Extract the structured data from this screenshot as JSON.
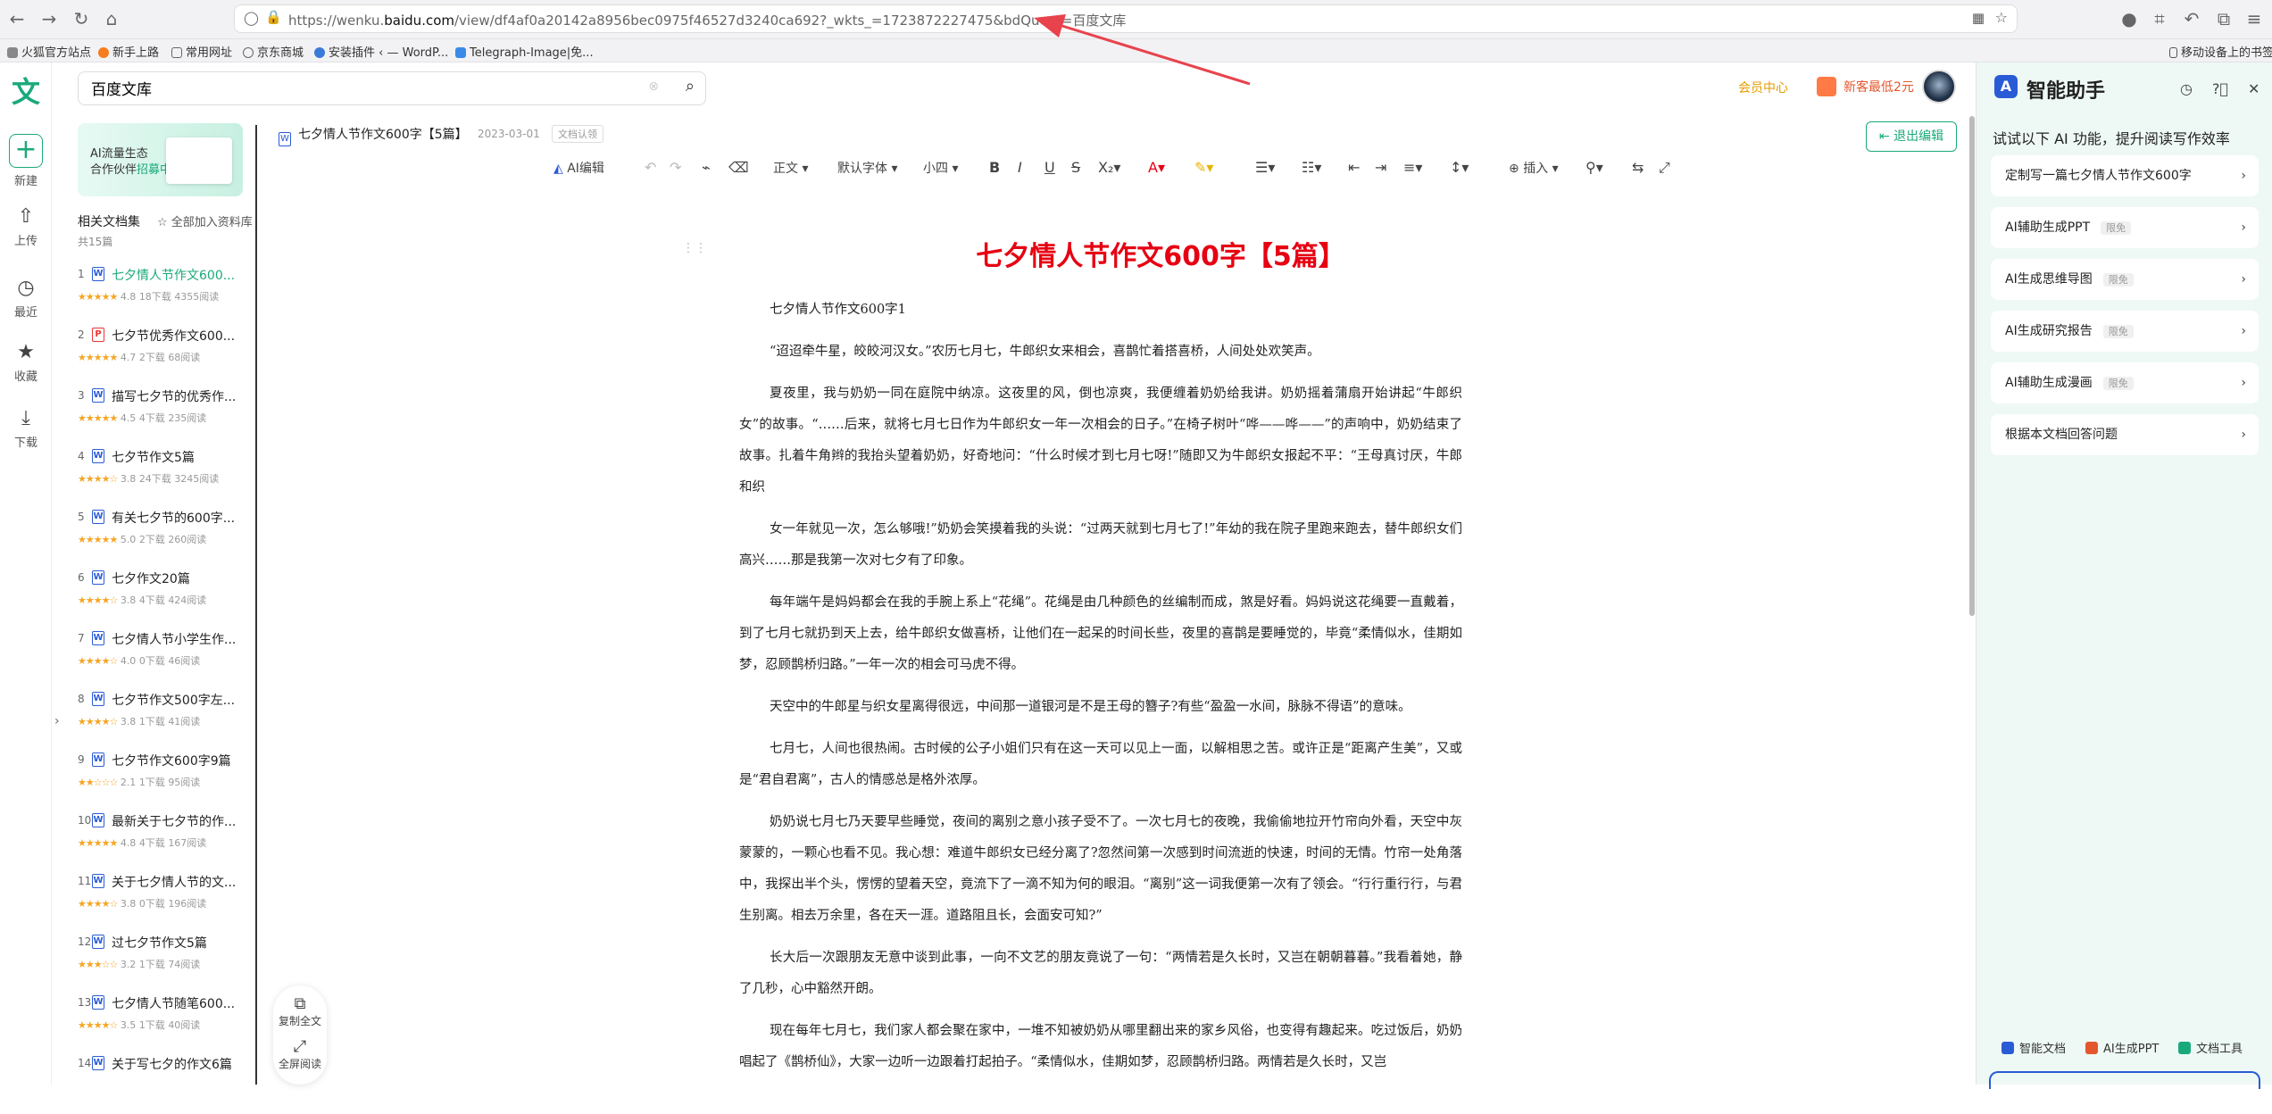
{
  "browser": {
    "url_prefix": "https://wenku.",
    "url_domain": "baidu.com",
    "url_rest": "/view/df4af0a20142a8956bec0975f46527d3240ca692?_wkts_=1723872227475&bdQuery=百度文库",
    "bookmarks": [
      "火狐官方站点",
      "新手上路",
      "常用网址",
      "京东商城",
      "安装插件 ‹ — WordP...",
      "Telegraph-Image|免..."
    ],
    "mobile_bookmarks": "移动设备上的书签"
  },
  "rail": {
    "logo": "文",
    "items": [
      {
        "label": "新建",
        "icon": "+"
      },
      {
        "label": "上传",
        "icon": "⇧"
      },
      {
        "label": "最近",
        "icon": "◷"
      },
      {
        "label": "收藏",
        "icon": "★"
      },
      {
        "label": "下载",
        "icon": "⤓"
      }
    ]
  },
  "search": {
    "value": "百度文库"
  },
  "banner": {
    "line1": "AI流量生态",
    "line2": "合作伙伴",
    "line2_highlight": "招募中"
  },
  "related": {
    "heading": "相关文档集",
    "add_all": "全部加入资料库",
    "count": "共15篇",
    "docs": [
      {
        "num": "1",
        "type": "W",
        "title": "七夕情人节作文600...",
        "rating": "4.8",
        "downloads": "18下载",
        "reads": "4355阅读",
        "stars": "★★★★★"
      },
      {
        "num": "2",
        "type": "P",
        "title": "七夕节优秀作文600...",
        "rating": "4.7",
        "downloads": "2下载",
        "reads": "68阅读",
        "stars": "★★★★★"
      },
      {
        "num": "3",
        "type": "W",
        "title": "描写七夕节的优秀作...",
        "rating": "4.5",
        "downloads": "4下载",
        "reads": "235阅读",
        "stars": "★★★★★"
      },
      {
        "num": "4",
        "type": "W",
        "title": "七夕节作文5篇",
        "rating": "3.8",
        "downloads": "24下载",
        "reads": "3245阅读",
        "stars": "★★★★☆"
      },
      {
        "num": "5",
        "type": "W",
        "title": "有关七夕节的600字...",
        "rating": "5.0",
        "downloads": "2下载",
        "reads": "260阅读",
        "stars": "★★★★★"
      },
      {
        "num": "6",
        "type": "W",
        "title": "七夕作文20篇",
        "rating": "3.8",
        "downloads": "4下载",
        "reads": "424阅读",
        "stars": "★★★★☆"
      },
      {
        "num": "7",
        "type": "W",
        "title": "七夕情人节小学生作...",
        "rating": "4.0",
        "downloads": "0下载",
        "reads": "46阅读",
        "stars": "★★★★☆"
      },
      {
        "num": "8",
        "type": "W",
        "title": "七夕节作文500字左...",
        "rating": "3.8",
        "downloads": "1下载",
        "reads": "41阅读",
        "stars": "★★★★☆"
      },
      {
        "num": "9",
        "type": "W",
        "title": "七夕节作文600字9篇",
        "rating": "2.1",
        "downloads": "1下载",
        "reads": "95阅读",
        "stars": "★★☆☆☆"
      },
      {
        "num": "10",
        "type": "W",
        "title": "最新关于七夕节的作...",
        "rating": "4.8",
        "downloads": "4下载",
        "reads": "167阅读",
        "stars": "★★★★★"
      },
      {
        "num": "11",
        "type": "W",
        "title": "关于七夕情人节的文...",
        "rating": "3.8",
        "downloads": "0下载",
        "reads": "196阅读",
        "stars": "★★★★☆"
      },
      {
        "num": "12",
        "type": "W",
        "title": "过七夕节作文5篇",
        "rating": "3.2",
        "downloads": "1下载",
        "reads": "74阅读",
        "stars": "★★★☆☆"
      },
      {
        "num": "13",
        "type": "W",
        "title": "七夕情人节随笔600...",
        "rating": "3.5",
        "downloads": "1下载",
        "reads": "40阅读",
        "stars": "★★★★☆"
      },
      {
        "num": "14",
        "type": "W",
        "title": "关于写七夕的作文6篇",
        "rating": "",
        "downloads": "",
        "reads": "",
        "stars": ""
      }
    ]
  },
  "doc": {
    "header_title": "七夕情人节作文600字【5篇】",
    "date": "2023-03-01",
    "badge": "文档认领",
    "exit_label": "退出编辑",
    "vip_label": "会员中心",
    "gift_label": "新客最低2元"
  },
  "toolbar": {
    "ai_edit": "AI编辑",
    "style": "正文",
    "font": "默认字体",
    "size": "小四",
    "insert": "插入"
  },
  "content": {
    "title": "七夕情人节作文600字【5篇】",
    "subtitle": "七夕情人节作文600字1",
    "paragraphs": [
      "“迢迢牵牛星，皎皎河汉女。”农历七月七，牛郎织女来相会，喜鹊忙着搭喜桥，人间处处欢笑声。",
      "夏夜里，我与奶奶一同在庭院中纳凉。这夜里的风，倒也凉爽，我便缠着奶奶给我讲。奶奶摇着蒲扇开始讲起“牛郎织女”的故事。“……后来，就将七月七日作为牛郎织女一年一次相会的日子。”在椅子树叶“哗——哗——”的声响中，奶奶结束了故事。扎着牛角辫的我抬头望着奶奶，好奇地问：“什么时候才到七月七呀!”随即又为牛郎织女报起不平：“王母真讨厌，牛郎和织",
      "女一年就见一次，怎么够哦!”奶奶会笑摸着我的头说：“过两天就到七月七了!”年幼的我在院子里跑来跑去，替牛郎织女们高兴……那是我第一次对七夕有了印象。",
      "每年端午是妈妈都会在我的手腕上系上“花绳”。花绳是由几种颜色的丝编制而成，煞是好看。妈妈说这花绳要一直戴着，到了七月七就扔到天上去，给牛郎织女做喜桥，让他们在一起呆的时间长些，夜里的喜鹊是要睡觉的，毕竟“柔情似水，佳期如梦，忍顾鹊桥归路。”一年一次的相会可马虎不得。",
      "天空中的牛郎星与织女星离得很远，中间那一道银河是不是王母的簪子?有些“盈盈一水间，脉脉不得语”的意味。",
      "七月七，人间也很热闹。古时候的公子小姐们只有在这一天可以见上一面，以解相思之苦。或许正是“距离产生美”，又或是“君自君离”，古人的情感总是格外浓厚。",
      "奶奶说七月七乃天要早些睡觉，夜间的离别之意小孩子受不了。一次七月七的夜晚，我偷偷地拉开竹帘向外看，天空中灰蒙蒙的，一颗心也看不见。我心想：难道牛郎织女已经分离了?忽然间第一次感到时间流逝的快速，时间的无情。竹帘一处角落中，我探出半个头，愣愣的望着天空，竟流下了一滴不知为何的眼泪。“离别”这一词我便第一次有了领会。“行行重行行，与君生别离。相去万余里，各在天一涯。道路阻且长，会面安可知?”",
      "长大后一次跟朋友无意中谈到此事，一向不文艺的朋友竟说了一句：“两情若是久长时，又岂在朝朝暮暮。”我看着她，静了几秒，心中豁然开朗。",
      "现在每年七月七，我们家人都会聚在家中，一堆不知被奶奶从哪里翻出来的家乡风俗，也变得有趣起来。吃过饭后，奶奶唱起了《鹊桥仙》，大家一边听一边跟着打起拍子。“柔情似水，佳期如梦，忍顾鹊桥归路。两情若是久长时，又岂"
    ]
  },
  "float": {
    "copy": "复制全文",
    "fullscreen": "全屏阅读"
  },
  "assistant": {
    "title": "智能助手",
    "subtitle": "试试以下 AI 功能，提升阅读写作效率",
    "cards": [
      {
        "label": "定制写一篇七夕情人节作文600字",
        "limit": ""
      },
      {
        "label": "AI辅助生成PPT",
        "limit": "限免"
      },
      {
        "label": "AI生成思维导图",
        "limit": "限免"
      },
      {
        "label": "AI生成研究报告",
        "limit": "限免"
      },
      {
        "label": "AI辅助生成漫画",
        "limit": "限免"
      },
      {
        "label": "根据本文档回答问题",
        "limit": ""
      }
    ],
    "bottom": [
      "智能文档",
      "AI生成PPT",
      "文档工具"
    ]
  },
  "colors": {
    "accent": "#1aa97b",
    "title_red": "#e60012",
    "assistant_bg": "#eef9f5",
    "arrow": "#e8434d"
  }
}
